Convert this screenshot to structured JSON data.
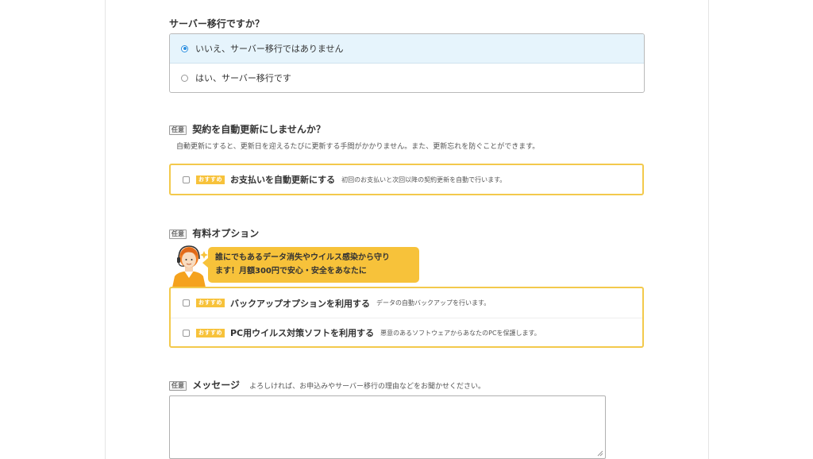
{
  "server_migration": {
    "question": "サーバー移行ですか？",
    "options": [
      {
        "label": "いいえ、サーバー移行ではありません",
        "selected": true
      },
      {
        "label": "はい、サーバー移行です",
        "selected": false
      }
    ]
  },
  "auto_renew": {
    "tag": "任意",
    "question": "契約を自動更新にしませんか？",
    "note": "自動更新にすると、更新日を迎えるたびに更新する手間がかかりません。また、更新忘れを防ぐことができます。",
    "option": {
      "badge": "おすすめ",
      "label": "お支払いを自動更新にする",
      "desc": "初回のお支払いと次回以降の契約更新を自動で行います。"
    }
  },
  "paid_options": {
    "tag": "任意",
    "heading": "有料オプション",
    "bubble_line1": "誰にでもあるデータ消失やウイルス感染から守り",
    "bubble_line2": "ます！月額300円で安心・安全をあなたに",
    "options": [
      {
        "badge": "おすすめ",
        "label": "バックアップオプションを利用する",
        "desc": "データの自動バックアップを行います。"
      },
      {
        "badge": "おすすめ",
        "label": "PC用ウイルス対策ソフトを利用する",
        "desc": "悪意のあるソフトウェアからあなたのPCを保護します。"
      }
    ]
  },
  "message": {
    "tag": "任意",
    "heading": "メッセージ",
    "note": "よろしければ、お申込みやサーバー移行の理由などをお聞かせください。",
    "value": ""
  },
  "colors": {
    "accent_yellow": "#f7c23a",
    "selected_bg": "#e6f4fc",
    "radio_blue": "#2b8fe0"
  }
}
